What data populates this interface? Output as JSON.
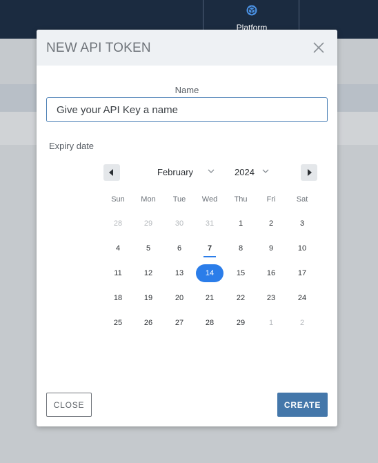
{
  "background": {
    "platform_tab_label": "Platform",
    "platform_icon": "cube-icon"
  },
  "modal": {
    "title": "NEW API TOKEN",
    "close_icon": "close-icon",
    "name_label": "Name",
    "name_placeholder": "Give your API Key a name",
    "name_value": "",
    "expiry_label": "Expiry date",
    "calendar": {
      "month": "February",
      "year": "2024",
      "weekdays": [
        "Sun",
        "Mon",
        "Tue",
        "Wed",
        "Thu",
        "Fri",
        "Sat"
      ],
      "weeks": [
        [
          {
            "d": "28",
            "muted": true
          },
          {
            "d": "29",
            "muted": true
          },
          {
            "d": "30",
            "muted": true
          },
          {
            "d": "31",
            "muted": true
          },
          {
            "d": "1"
          },
          {
            "d": "2"
          },
          {
            "d": "3"
          }
        ],
        [
          {
            "d": "4"
          },
          {
            "d": "5"
          },
          {
            "d": "6"
          },
          {
            "d": "7",
            "today": true
          },
          {
            "d": "8"
          },
          {
            "d": "9"
          },
          {
            "d": "10"
          }
        ],
        [
          {
            "d": "11"
          },
          {
            "d": "12"
          },
          {
            "d": "13"
          },
          {
            "d": "14",
            "selected": true
          },
          {
            "d": "15"
          },
          {
            "d": "16"
          },
          {
            "d": "17"
          }
        ],
        [
          {
            "d": "18"
          },
          {
            "d": "19"
          },
          {
            "d": "20"
          },
          {
            "d": "21"
          },
          {
            "d": "22"
          },
          {
            "d": "23"
          },
          {
            "d": "24"
          }
        ],
        [
          {
            "d": "25"
          },
          {
            "d": "26"
          },
          {
            "d": "27"
          },
          {
            "d": "28"
          },
          {
            "d": "29"
          },
          {
            "d": "1",
            "muted": true
          },
          {
            "d": "2",
            "muted": true
          }
        ]
      ],
      "prev_icon": "triangle-left-icon",
      "next_icon": "triangle-right-icon"
    },
    "close_button": "CLOSE",
    "create_button": "CREATE"
  },
  "colors": {
    "topbar": "#1b2b40",
    "accent": "#2b7de9",
    "create_button": "#4477aa"
  }
}
